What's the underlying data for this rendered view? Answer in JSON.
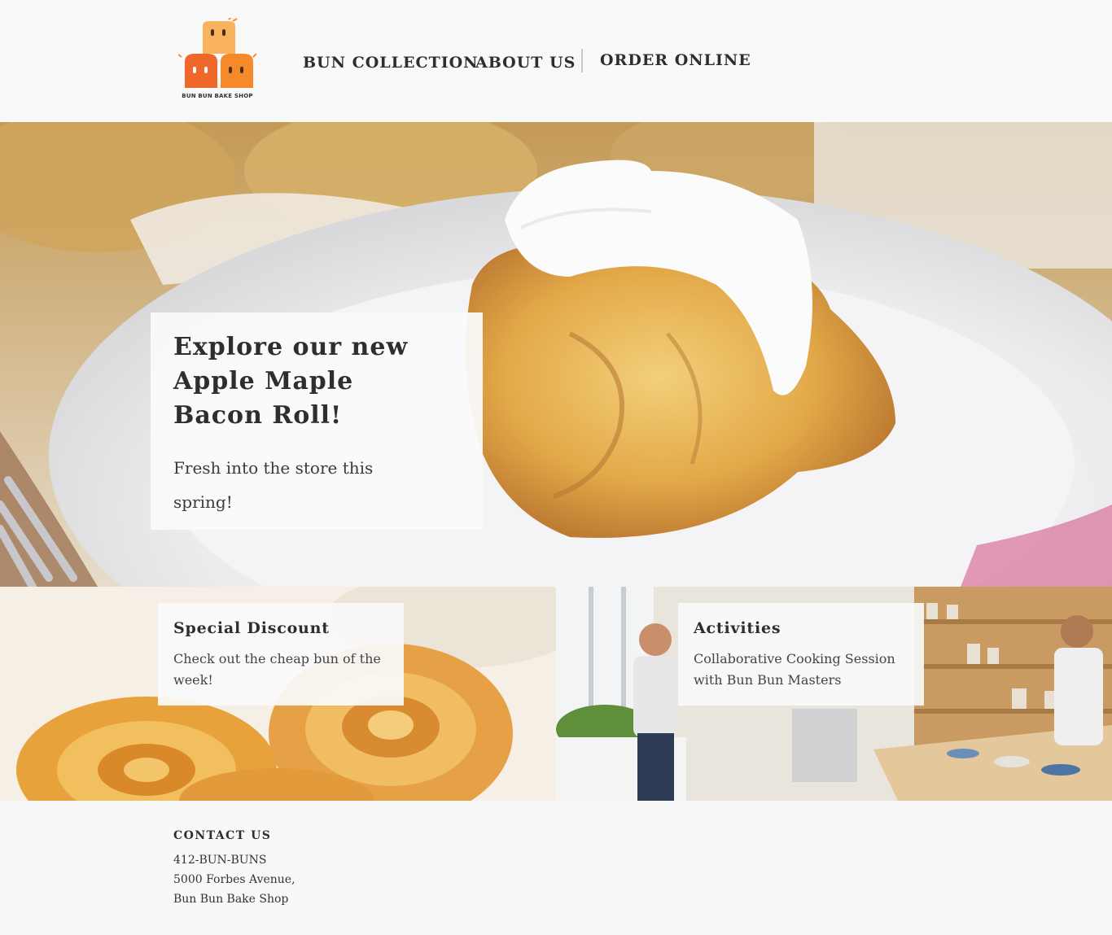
{
  "brand": {
    "logo_text": "BUN BUN BAKE SHOP",
    "colors": {
      "orange": "#f68a2b",
      "light_orange": "#f9b35c",
      "deep_orange": "#f0672a"
    }
  },
  "nav": {
    "items": [
      {
        "label": "BUN COLLECTION"
      },
      {
        "label": "ABOUT US"
      },
      {
        "label": "ORDER ONLINE"
      }
    ]
  },
  "hero": {
    "title": "Explore our new Apple Maple Bacon Roll!",
    "subtitle": "Fresh into the store this spring!"
  },
  "features": [
    {
      "title": "Special Discount",
      "text": "Check out the cheap bun of the week!"
    },
    {
      "title": "Activities",
      "text": "Collaborative Cooking Session with Bun Bun Masters"
    }
  ],
  "footer": {
    "heading": "CONTACT US",
    "phone": "412-BUN-BUNS",
    "address": "5000 Forbes Avenue,",
    "shop": "Bun Bun Bake Shop"
  }
}
